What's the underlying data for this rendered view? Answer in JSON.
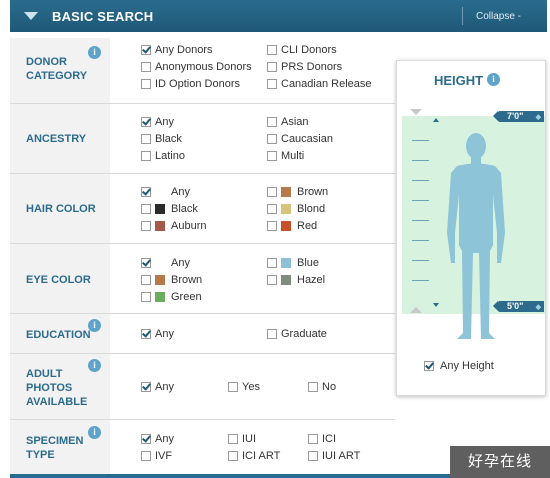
{
  "header": {
    "title": "BASIC SEARCH",
    "collapse": "Collapse -"
  },
  "info_glyph": "i",
  "rows": {
    "donor_category": {
      "label_lines": [
        "DONOR",
        "CATEGORY"
      ],
      "options": [
        {
          "label": "Any Donors",
          "checked": true
        },
        {
          "label": "Anonymous Donors",
          "checked": false
        },
        {
          "label": "ID Option Donors",
          "checked": false
        },
        {
          "label": "CLI Donors",
          "checked": false
        },
        {
          "label": "PRS Donors",
          "checked": false
        },
        {
          "label": "Canadian Release",
          "checked": false
        }
      ]
    },
    "ancestry": {
      "label_lines": [
        "ANCESTRY"
      ],
      "options": [
        {
          "label": "Any",
          "checked": true
        },
        {
          "label": "Black",
          "checked": false
        },
        {
          "label": "Latino",
          "checked": false
        },
        {
          "label": "Asian",
          "checked": false
        },
        {
          "label": "Caucasian",
          "checked": false
        },
        {
          "label": "Multi",
          "checked": false
        }
      ]
    },
    "hair_color": {
      "label_lines": [
        "HAIR COLOR"
      ],
      "options": [
        {
          "label": "Any",
          "checked": true,
          "swatch": ""
        },
        {
          "label": "Black",
          "checked": false,
          "swatch": "#2b2b2b"
        },
        {
          "label": "Auburn",
          "checked": false,
          "swatch": "#a3584a"
        },
        {
          "label": "Brown",
          "checked": false,
          "swatch": "#b5794a"
        },
        {
          "label": "Blond",
          "checked": false,
          "swatch": "#d7c37c"
        },
        {
          "label": "Red",
          "checked": false,
          "swatch": "#c8502c"
        }
      ]
    },
    "eye_color": {
      "label_lines": [
        "EYE COLOR"
      ],
      "options": [
        {
          "label": "Any",
          "checked": true,
          "swatch": ""
        },
        {
          "label": "Brown",
          "checked": false,
          "swatch": "#b5794a"
        },
        {
          "label": "Green",
          "checked": false,
          "swatch": "#6aad5c"
        },
        {
          "label": "Blue",
          "checked": false,
          "swatch": "#8cc0d9"
        },
        {
          "label": "Hazel",
          "checked": false,
          "swatch": "#7d8c7d"
        }
      ]
    },
    "education": {
      "label_lines": [
        "EDUCATION"
      ],
      "options": [
        {
          "label": "Any",
          "checked": true
        },
        {
          "label": "Graduate",
          "checked": false
        }
      ]
    },
    "adult_photos": {
      "label_lines": [
        "ADULT",
        "PHOTOS",
        "AVAILABLE"
      ],
      "options": [
        {
          "label": "Any",
          "checked": true
        },
        {
          "label": "Yes",
          "checked": false
        },
        {
          "label": "No",
          "checked": false
        }
      ]
    },
    "specimen_type": {
      "label_lines": [
        "SPECIMEN",
        "TYPE"
      ],
      "options": [
        {
          "label": "Any",
          "checked": true
        },
        {
          "label": "IVF",
          "checked": false
        },
        {
          "label": "IUI",
          "checked": false
        },
        {
          "label": "ICI ART",
          "checked": false
        },
        {
          "label": "ICI",
          "checked": false
        },
        {
          "label": "IUI ART",
          "checked": false
        }
      ]
    }
  },
  "height_panel": {
    "title": "HEIGHT",
    "max_label": "7'0\"",
    "min_label": "5'0\"",
    "any_height_label": "Any Height",
    "any_height_checked": true
  },
  "watermark": "好孕在线",
  "colors": {
    "header": "#1f5877",
    "label_text": "#2c6b8c",
    "range_zone": "#d7f2de",
    "silhouette": "#8ec4d8"
  }
}
